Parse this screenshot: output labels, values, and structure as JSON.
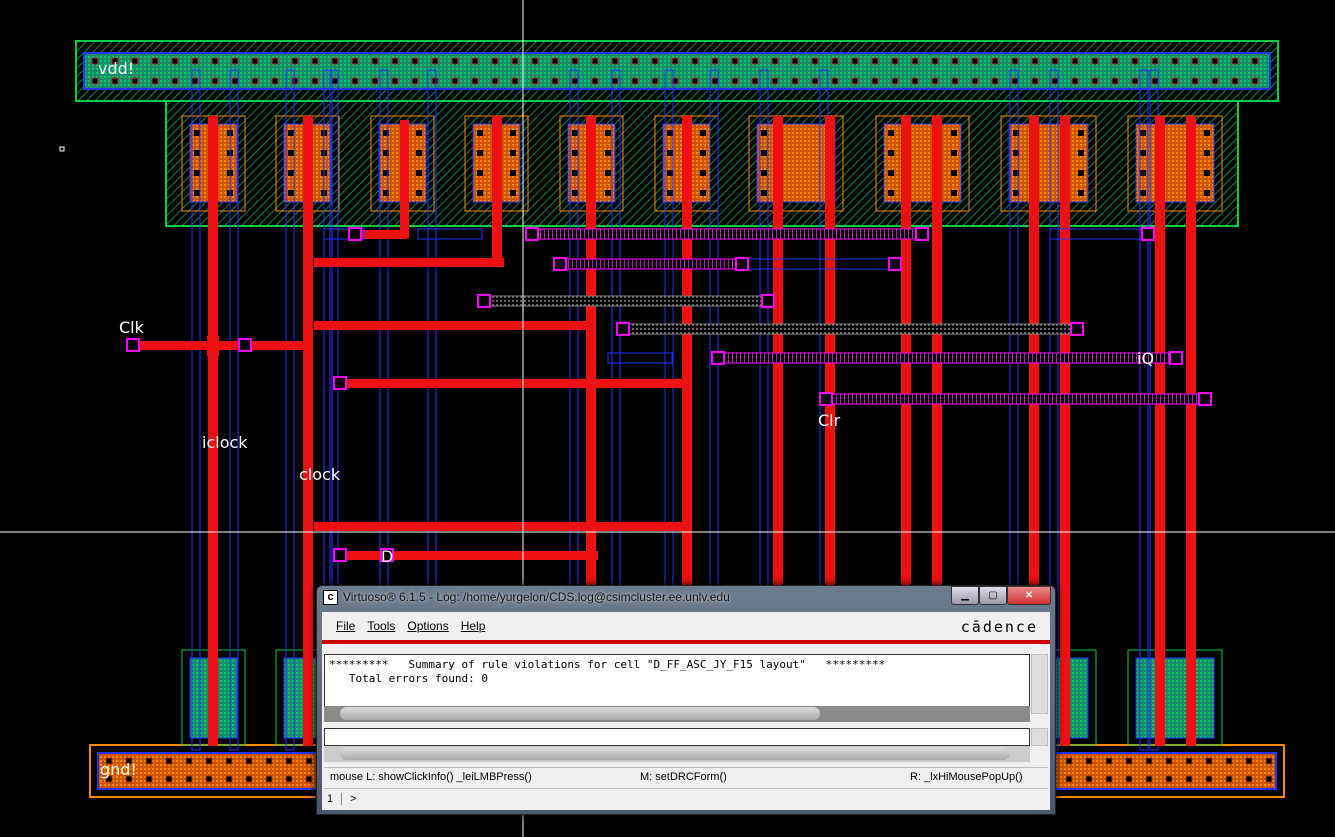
{
  "layout": {
    "labels": {
      "vdd": "vdd!",
      "gnd": "gnd!",
      "clk": "Clk",
      "iclock": "iclock",
      "clock": "clock",
      "iq": "iQ",
      "clr": "Clr",
      "d": "D"
    },
    "colors": {
      "metal1": "#0000ff",
      "poly": "#ff0000",
      "nwell": "#00cc44",
      "pdiff": "#ff8800",
      "metal2": "#ff00ff",
      "background": "#000000"
    }
  },
  "window": {
    "app_icon": "cadence-c-icon",
    "title": "Virtuoso® 6.1.5 - Log: /home/yurgelon/CDS.log@csimcluster.ee.unlv.edu",
    "minimize_icon": "minimize-icon",
    "maximize_icon": "maximize-icon",
    "close_icon": "close-icon",
    "menu": [
      "File",
      "Tools",
      "Options",
      "Help"
    ],
    "logo": "cādence",
    "log_lines": [
      "*********   Summary of rule violations for cell \"D_FF_ASC_JY_F15 layout\"   *********",
      "   Total errors found: 0"
    ],
    "command_input": "",
    "status": {
      "left": "mouse L: showClickInfo() _leiLMBPress()",
      "middle": "M: setDRCForm()",
      "right": "R: _lxHiMousePopUp()"
    },
    "prompt_number": "1",
    "prompt": ">"
  }
}
